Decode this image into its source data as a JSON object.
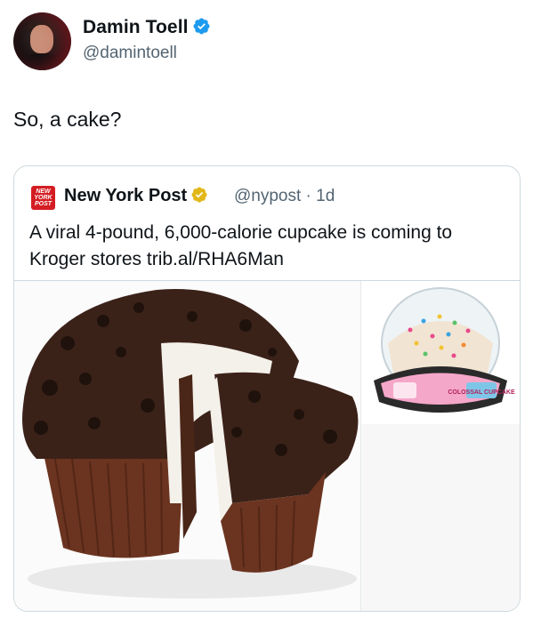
{
  "author": {
    "name": "Damin Toell",
    "handle": "@damintoell",
    "avatar_icon": "profile-photo",
    "verified_color": "#1d9bf0"
  },
  "tweet": {
    "text": "So, a cake?"
  },
  "quoted": {
    "logo_text": "NEW YORK POST",
    "logo_color": "#d41d23",
    "name": "New York Post",
    "verified_color": "#e2b719",
    "handle_time": "@nypost · 1d",
    "text": "A viral 4-pound, 6,000-calorie cupcake is coming to Kroger stores trib.al/RHA6Man",
    "images": [
      {
        "name": "giant-chocolate-cupcake-photo"
      },
      {
        "name": "funfetti-cupcake-package-photo",
        "package_label": "COLOSSAL CUPCAKE"
      }
    ]
  }
}
